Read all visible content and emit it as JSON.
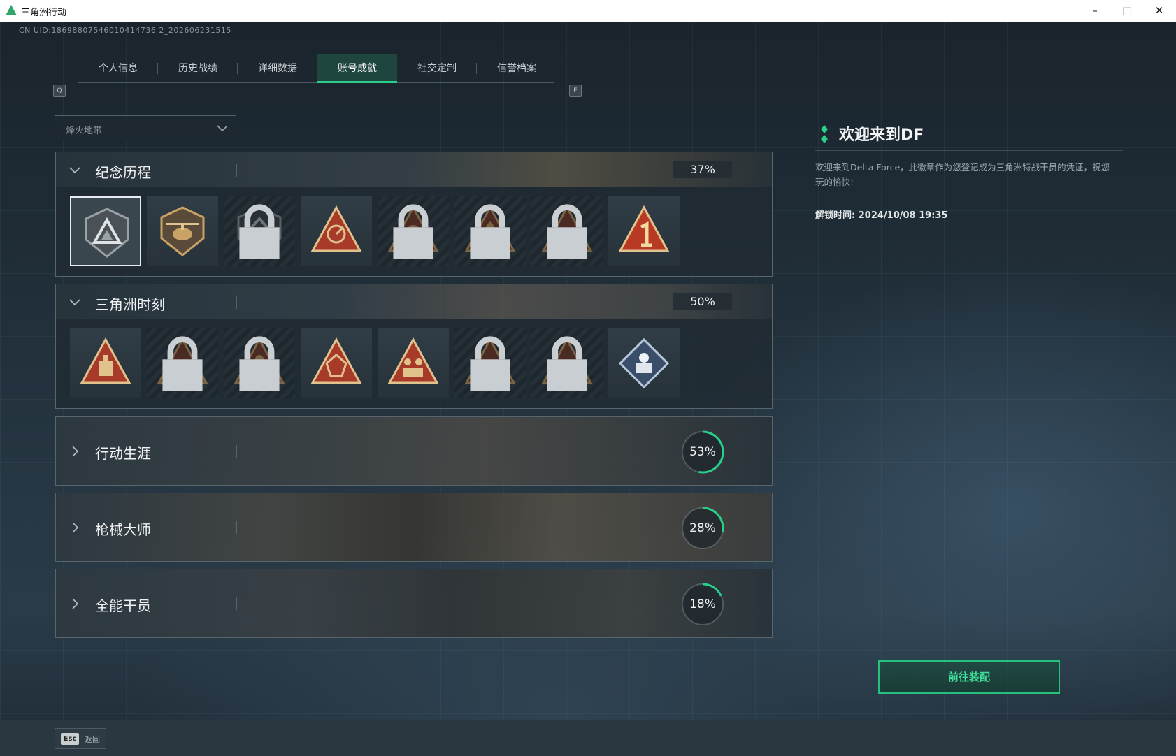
{
  "window": {
    "title": "三角洲行动",
    "minimize": "–",
    "maximize": "□",
    "close": "✕"
  },
  "uid_text": "CN UID:18698807546010414736 2_202606231515",
  "tabs": {
    "left_key": "Q",
    "right_key": "E",
    "items": [
      {
        "label": "个人信息"
      },
      {
        "label": "历史战绩"
      },
      {
        "label": "详细数据"
      },
      {
        "label": "账号成就",
        "active": true
      },
      {
        "label": "社交定制"
      },
      {
        "label": "信誉档案"
      }
    ]
  },
  "mode_select": {
    "value": "烽火地带"
  },
  "sections": [
    {
      "title": "纪念历程",
      "percent": "37%",
      "expanded": true,
      "badges": [
        {
          "icon": "delta-shield-badge",
          "locked": false,
          "selected": true
        },
        {
          "icon": "helicopter-badge",
          "locked": false
        },
        {
          "icon": "diamond-emblem-badge",
          "locked": true
        },
        {
          "icon": "radar-dish-badge",
          "locked": false
        },
        {
          "icon": "soldier-badge",
          "locked": true
        },
        {
          "icon": "hooded-figure-badge",
          "locked": true
        },
        {
          "icon": "skull-swords-badge",
          "locked": true
        },
        {
          "icon": "number-one-badge",
          "locked": false
        }
      ]
    },
    {
      "title": "三角洲时刻",
      "percent": "50%",
      "expanded": true,
      "badges": [
        {
          "icon": "supply-crate-badge",
          "locked": false
        },
        {
          "icon": "vault-badge",
          "locked": true
        },
        {
          "icon": "kneeling-figure-badge",
          "locked": true
        },
        {
          "icon": "dice-badge",
          "locked": false
        },
        {
          "icon": "team-badge",
          "locked": false
        },
        {
          "icon": "beast-badge",
          "locked": true
        },
        {
          "icon": "dragon-badge",
          "locked": true
        },
        {
          "icon": "rose-book-badge",
          "locked": false
        }
      ]
    },
    {
      "title": "行动生涯",
      "percent": "53%",
      "progress": 0.53,
      "expanded": false
    },
    {
      "title": "枪械大师",
      "percent": "28%",
      "progress": 0.28,
      "expanded": false
    },
    {
      "title": "全能干员",
      "percent": "18%",
      "progress": 0.18,
      "expanded": false
    }
  ],
  "detail": {
    "title": "欢迎来到DF",
    "description": "欢迎来到Delta Force，此徽章作为您登记成为三角洲特战干员的凭证，祝您玩的愉快!",
    "unlock_time": "解锁时间: 2024/10/08 19:35"
  },
  "equip_button": "前往装配",
  "esc": {
    "key": "Esc",
    "label": "返回"
  },
  "colors": {
    "accent": "#2ad08a",
    "badge_gold": "#c9a266",
    "badge_red": "#a83a2a"
  }
}
